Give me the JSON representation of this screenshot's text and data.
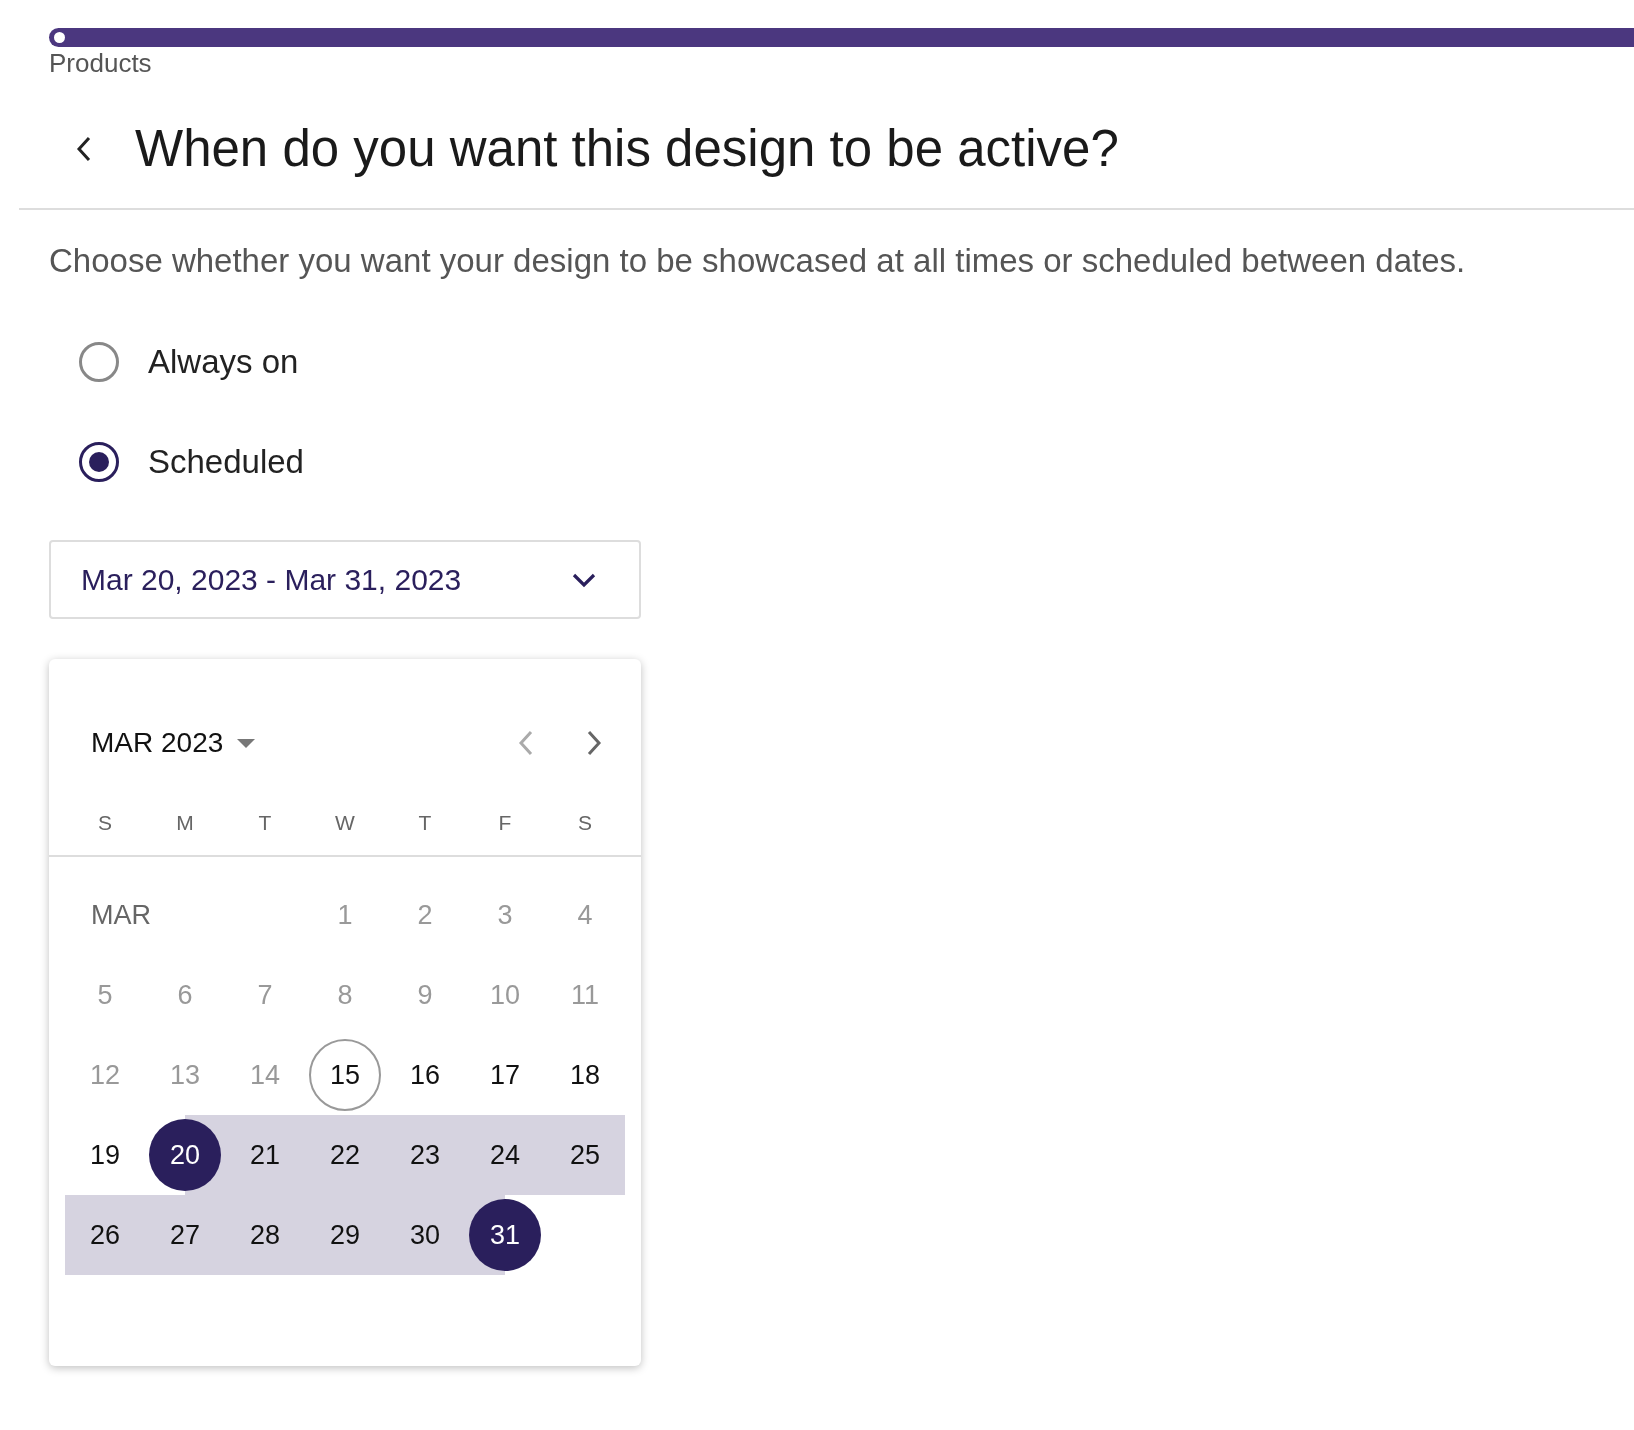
{
  "progress": {
    "level": 1
  },
  "breadcrumb": "Products",
  "title": "When do you want this design to be active?",
  "description": "Choose whether you want your design to be showcased at all times or scheduled between dates.",
  "options": [
    {
      "label": "Always on",
      "selected": false
    },
    {
      "label": "Scheduled",
      "selected": true
    }
  ],
  "date_range": {
    "value": "Mar 20, 2023 - Mar 31, 2023"
  },
  "calendar": {
    "month_year": "MAR 2023",
    "weekdays": [
      "S",
      "M",
      "T",
      "W",
      "T",
      "F",
      "S"
    ],
    "month_label": "MAR",
    "days": [
      {
        "label": "1",
        "disabled": true,
        "today": false,
        "selected": false,
        "in_range": false
      },
      {
        "label": "2",
        "disabled": true,
        "today": false,
        "selected": false,
        "in_range": false
      },
      {
        "label": "3",
        "disabled": true,
        "today": false,
        "selected": false,
        "in_range": false
      },
      {
        "label": "4",
        "disabled": true,
        "today": false,
        "selected": false,
        "in_range": false
      },
      {
        "label": "5",
        "disabled": true,
        "today": false,
        "selected": false,
        "in_range": false
      },
      {
        "label": "6",
        "disabled": true,
        "today": false,
        "selected": false,
        "in_range": false
      },
      {
        "label": "7",
        "disabled": true,
        "today": false,
        "selected": false,
        "in_range": false
      },
      {
        "label": "8",
        "disabled": true,
        "today": false,
        "selected": false,
        "in_range": false
      },
      {
        "label": "9",
        "disabled": true,
        "today": false,
        "selected": false,
        "in_range": false
      },
      {
        "label": "10",
        "disabled": true,
        "today": false,
        "selected": false,
        "in_range": false
      },
      {
        "label": "11",
        "disabled": true,
        "today": false,
        "selected": false,
        "in_range": false
      },
      {
        "label": "12",
        "disabled": true,
        "today": false,
        "selected": false,
        "in_range": false
      },
      {
        "label": "13",
        "disabled": true,
        "today": false,
        "selected": false,
        "in_range": false
      },
      {
        "label": "14",
        "disabled": true,
        "today": false,
        "selected": false,
        "in_range": false
      },
      {
        "label": "15",
        "disabled": false,
        "today": true,
        "selected": false,
        "in_range": false
      },
      {
        "label": "16",
        "disabled": false,
        "today": false,
        "selected": false,
        "in_range": false
      },
      {
        "label": "17",
        "disabled": false,
        "today": false,
        "selected": false,
        "in_range": false
      },
      {
        "label": "18",
        "disabled": false,
        "today": false,
        "selected": false,
        "in_range": false
      },
      {
        "label": "19",
        "disabled": false,
        "today": false,
        "selected": false,
        "in_range": false
      },
      {
        "label": "20",
        "disabled": false,
        "today": false,
        "selected": true,
        "in_range": true
      },
      {
        "label": "21",
        "disabled": false,
        "today": false,
        "selected": false,
        "in_range": true
      },
      {
        "label": "22",
        "disabled": false,
        "today": false,
        "selected": false,
        "in_range": true
      },
      {
        "label": "23",
        "disabled": false,
        "today": false,
        "selected": false,
        "in_range": true
      },
      {
        "label": "24",
        "disabled": false,
        "today": false,
        "selected": false,
        "in_range": true
      },
      {
        "label": "25",
        "disabled": false,
        "today": false,
        "selected": false,
        "in_range": true
      },
      {
        "label": "26",
        "disabled": false,
        "today": false,
        "selected": false,
        "in_range": true
      },
      {
        "label": "27",
        "disabled": false,
        "today": false,
        "selected": false,
        "in_range": true
      },
      {
        "label": "28",
        "disabled": false,
        "today": false,
        "selected": false,
        "in_range": true
      },
      {
        "label": "29",
        "disabled": false,
        "today": false,
        "selected": false,
        "in_range": true
      },
      {
        "label": "30",
        "disabled": false,
        "today": false,
        "selected": false,
        "in_range": true
      },
      {
        "label": "31",
        "disabled": false,
        "today": false,
        "selected": true,
        "in_range": true
      }
    ]
  }
}
